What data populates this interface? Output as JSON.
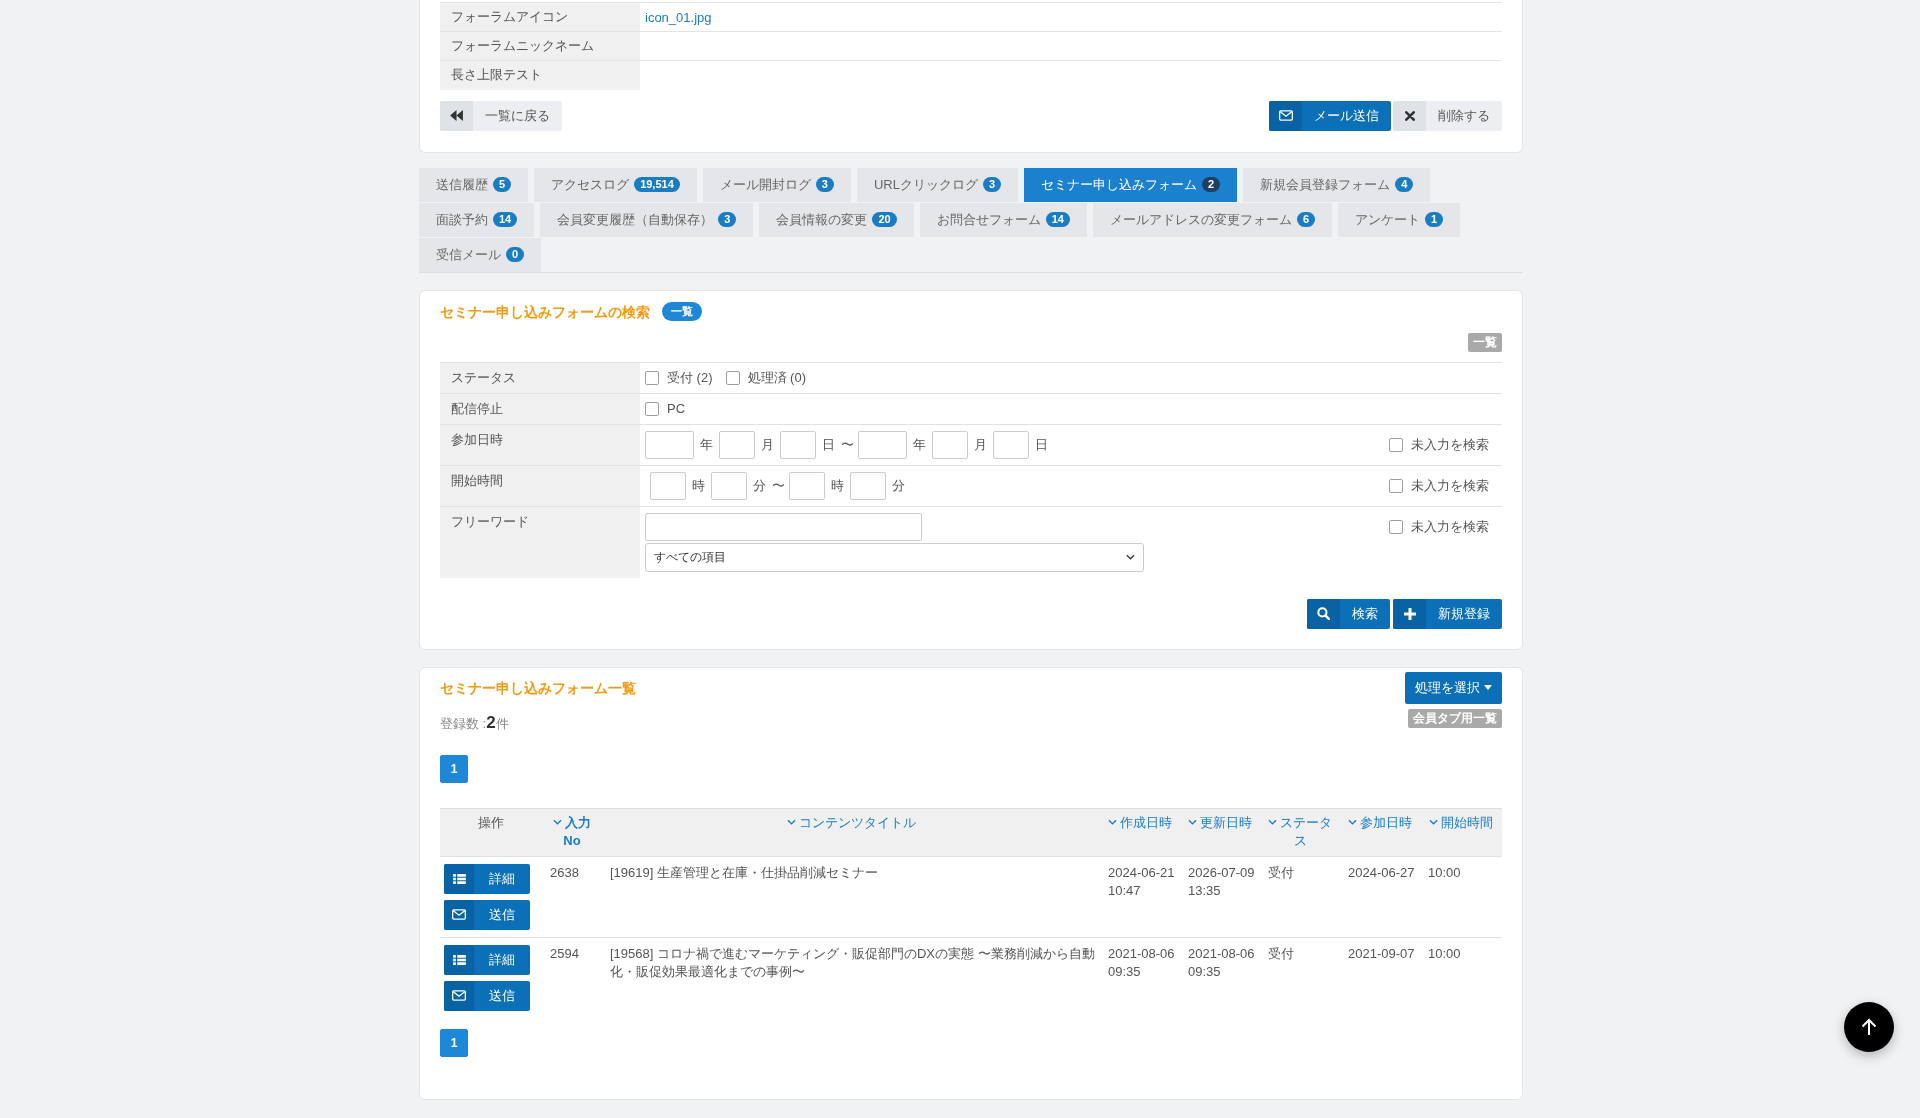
{
  "profile": {
    "rows": [
      {
        "label": "フォーラムアイコン",
        "link": "icon_01.jpg"
      },
      {
        "label": "フォーラムニックネーム"
      },
      {
        "label": "長さ上限テスト"
      }
    ],
    "back_button": "一覧に戻る",
    "mail_button": "メール送信",
    "delete_button": "削除する"
  },
  "tabs": [
    {
      "label": "送信履歴",
      "count": "5",
      "selected": false
    },
    {
      "label": "アクセスログ",
      "count": "19,514",
      "selected": false
    },
    {
      "label": "メール開封ログ",
      "count": "3",
      "selected": false
    },
    {
      "label": "URLクリックログ",
      "count": "3",
      "selected": false
    },
    {
      "label": "セミナー申し込みフォーム",
      "count": "2",
      "selected": true
    },
    {
      "label": "新規会員登録フォーム",
      "count": "4",
      "selected": false
    },
    {
      "label": "面談予約",
      "count": "14",
      "selected": false
    },
    {
      "label": "会員変更履歴（自動保存）",
      "count": "3",
      "selected": false
    },
    {
      "label": "会員情報の変更",
      "count": "20",
      "selected": false
    },
    {
      "label": "お問合せフォーム",
      "count": "14",
      "selected": false
    },
    {
      "label": "メールアドレスの変更フォーム",
      "count": "6",
      "selected": false
    },
    {
      "label": "アンケート",
      "count": "1",
      "selected": false
    },
    {
      "label": "受信メール",
      "count": "0",
      "selected": false
    }
  ],
  "search_panel": {
    "title": "セミナー申し込みフォームの検索",
    "title_badge": "一覧",
    "corner_tag": "一覧",
    "fields": [
      {
        "kind": "checkboxes",
        "label": "ステータス",
        "options": [
          {
            "label": "受付 (2)",
            "checked": false
          },
          {
            "label": "処理済 (0)",
            "checked": false
          }
        ]
      },
      {
        "kind": "checkboxes",
        "label": "配信停止",
        "options": [
          {
            "label": "PC",
            "checked": false
          }
        ]
      },
      {
        "kind": "date_range",
        "label": "参加日時",
        "from": [
          "年",
          "月",
          "日"
        ],
        "separator": "〜",
        "to": [
          "年",
          "月",
          "日"
        ],
        "blank_search": {
          "label": "未入力を検索",
          "checked": false
        }
      },
      {
        "kind": "time_range",
        "label": "開始時間",
        "from": [
          "時",
          "分"
        ],
        "separator": "〜",
        "to": [
          "時",
          "分"
        ],
        "blank_search": {
          "label": "未入力を検索",
          "checked": false
        }
      },
      {
        "kind": "freeword",
        "label": "フリーワード",
        "scope": "すべての項目",
        "blank_search": {
          "label": "未入力を検索",
          "checked": false
        }
      }
    ],
    "search_button": "検索",
    "new_button": "新規登録"
  },
  "list_panel": {
    "title": "セミナー申し込みフォーム一覧",
    "action_menu": "処理を選択",
    "member_tab_tag": "会員タブ用一覧",
    "record_count": "登録数 :**2**件",
    "pagination_top": [
      {
        "label": "1",
        "selected": true
      }
    ],
    "table": {
      "columns": [
        {
          "label": "操作",
          "sortable": false,
          "sorted": false
        },
        {
          "label": "入力No",
          "sortable": true,
          "sorted": true
        },
        {
          "label": "コンテンツタイトル",
          "sortable": true,
          "sorted": false
        },
        {
          "label": "作成日時",
          "sortable": true,
          "sorted": false
        },
        {
          "label": "更新日時",
          "sortable": true,
          "sorted": false
        },
        {
          "label": "ステータス",
          "sortable": true,
          "sorted": false
        },
        {
          "label": "参加日時",
          "sortable": true,
          "sorted": false
        },
        {
          "label": "開始時間",
          "sortable": true,
          "sorted": false
        }
      ],
      "rows": [
        {
          "cells": [
            [
              {
                "kind": "detail",
                "label": "詳細"
              },
              {
                "kind": "send",
                "label": "送信"
              }
            ],
            "2638",
            "[19619] 生産管理と在庫・仕掛品削減セミナー",
            "2024-06-21 10:47",
            "2026-07-09 13:35",
            "受付",
            "2024-06-27",
            "10:00"
          ]
        },
        {
          "cells": [
            [
              {
                "kind": "detail",
                "label": "詳細"
              },
              {
                "kind": "send",
                "label": "送信"
              }
            ],
            "2594",
            "[19568] コロナ禍で進むマーケティング・販促部門のDXの実態 〜業務削減から自動化・販促効果最適化までの事例〜",
            "2021-08-06 09:35",
            "2021-08-06 09:35",
            "受付",
            "2021-09-07",
            "10:00"
          ]
        }
      ]
    },
    "pagination_bottom": [
      {
        "label": "1",
        "selected": true
      }
    ]
  }
}
